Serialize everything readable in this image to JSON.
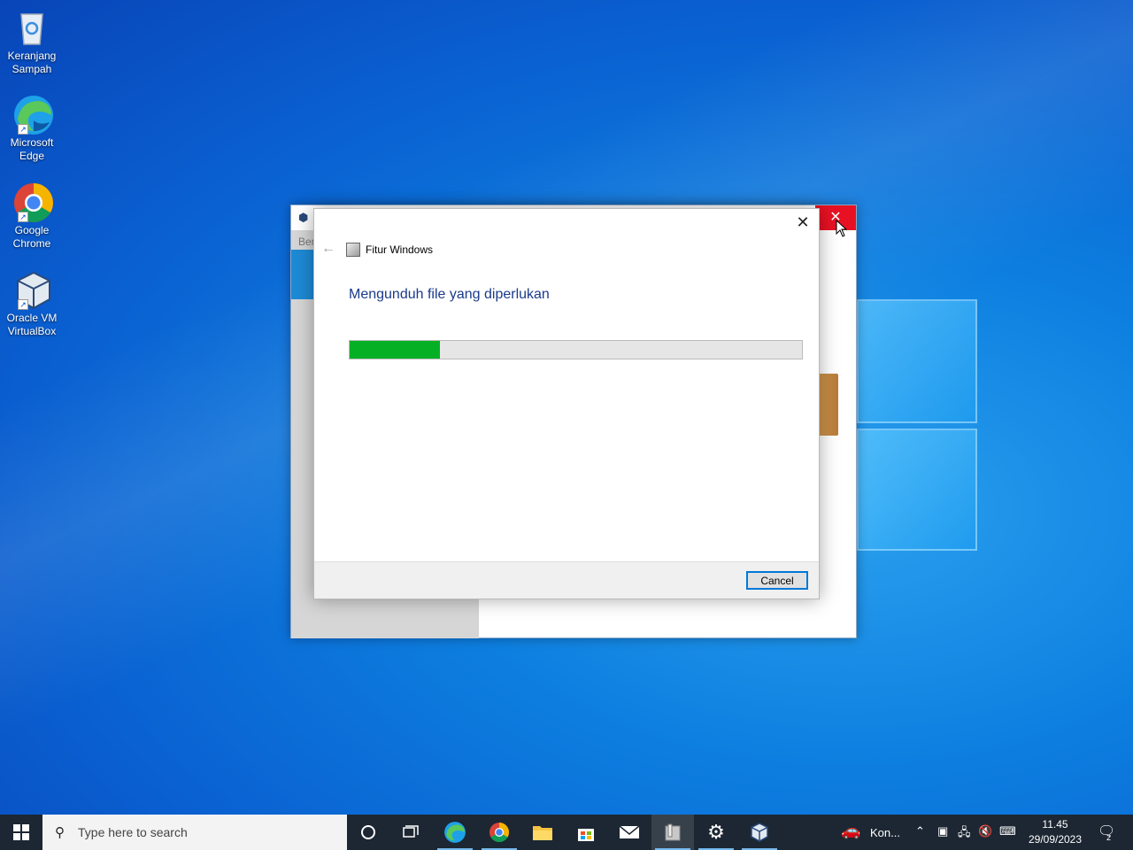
{
  "desktop": {
    "icons": [
      {
        "label": "Keranjang Sampah",
        "icon": "recycle-bin-icon"
      },
      {
        "label": "Microsoft Edge",
        "icon": "edge-icon"
      },
      {
        "label": "Google Chrome",
        "icon": "chrome-icon"
      },
      {
        "label": "Oracle VM VirtualBox",
        "icon": "virtualbox-icon"
      }
    ]
  },
  "background_window": {
    "sidebar_text": "Ber",
    "close_glyph": "✕"
  },
  "dialog": {
    "app_title": "Fitur Windows",
    "heading": "Mengunduh file yang diperlukan",
    "progress_percent": 20,
    "cancel_label": "Cancel",
    "close_glyph": "✕",
    "back_glyph": "←"
  },
  "taskbar": {
    "search_placeholder": "Type here to search",
    "pinned": [
      "cortana-icon",
      "task-view-icon",
      "edge-icon",
      "chrome-icon",
      "file-explorer-icon",
      "store-icon",
      "mail-icon",
      "windows-features-icon",
      "settings-icon",
      "virtualbox-icon"
    ],
    "tray_app_label": "Kon...",
    "time": "11.45",
    "date": "29/09/2023",
    "notification_count": "2"
  },
  "colors": {
    "progress_fill": "#06b025",
    "heading": "#1a3a8a",
    "close_red": "#e81123",
    "taskbar": "#1c2733"
  }
}
